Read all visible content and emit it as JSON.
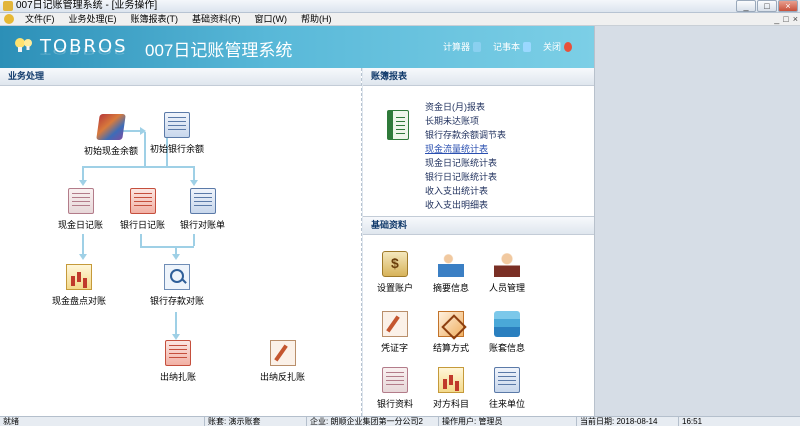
{
  "window": {
    "title": "007日记账管理系统 - [业务操作]",
    "buttons": [
      "_",
      "□",
      "×"
    ]
  },
  "menu": {
    "items": [
      "文件(F)",
      "业务处理(E)",
      "账簿报表(T)",
      "基础资料(R)",
      "窗口(W)",
      "帮助(H)"
    ],
    "mdi_buttons": [
      "_",
      "□",
      "×"
    ]
  },
  "header": {
    "brand": "TOBROS",
    "title": "007日记账管理系统",
    "links": [
      {
        "label": "计算器",
        "icon": "calculator-icon",
        "color": "#8ad0f0"
      },
      {
        "label": "记事本",
        "icon": "notepad-icon",
        "color": "#9ad8ff"
      },
      {
        "label": "关闭",
        "icon": "close-icon",
        "color": "#e8503a"
      }
    ]
  },
  "business": {
    "header": "业务处理",
    "nodes": {
      "init_cash": "初始现金余额",
      "init_bank": "初始银行余额",
      "cash_journal": "现金日记账",
      "bank_journal": "银行日记账",
      "bank_reconcile": "银行对账单",
      "cash_check": "现金盘点对账",
      "bank_deposit_check": "银行存款对账",
      "close_books": "出纳扎账",
      "reverse_close": "出纳反扎账"
    }
  },
  "reports": {
    "header": "账簿报表",
    "items": [
      "资金日(月)报表",
      "长期未达账项",
      "银行存款余额调节表",
      "现金流量统计表",
      "现金日记账统计表",
      "银行日记账统计表",
      "收入支出统计表",
      "收入支出明细表"
    ],
    "active_index": 3
  },
  "basic": {
    "header": "基础资料",
    "items": [
      "设置账户",
      "摘要信息",
      "人员管理",
      "凭证字",
      "结算方式",
      "账套信息",
      "银行资料",
      "对方科目",
      "往来单位"
    ]
  },
  "status": {
    "state": "就绪",
    "account_label": "账套:",
    "account": "演示账套",
    "company_label": "企业:",
    "company": "朗顺企业集团第一分公司2",
    "user_label": "操作用户:",
    "user": "管理员",
    "date_label": "当前日期:",
    "date": "2018-08-14",
    "time": "16:51"
  }
}
